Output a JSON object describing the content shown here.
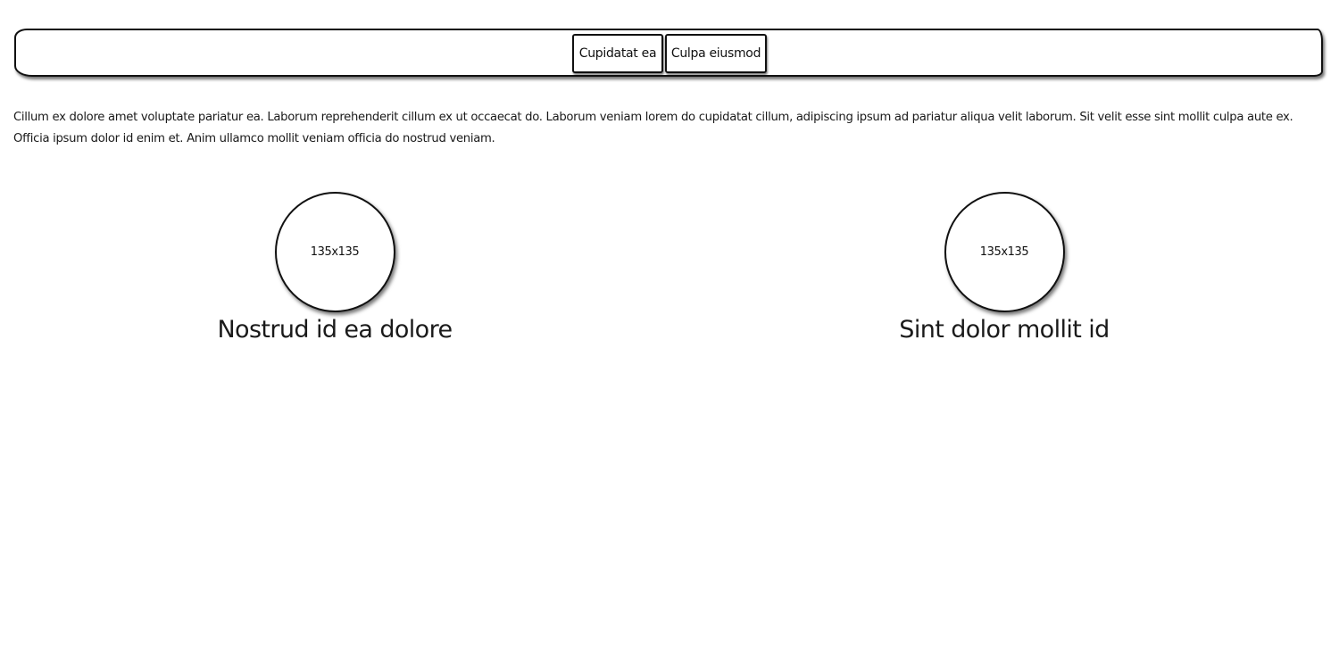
{
  "navbar": {
    "buttons": [
      {
        "label": "Cupidatat ea"
      },
      {
        "label": "Culpa eiusmod"
      }
    ]
  },
  "content": {
    "paragraph": "Cillum ex dolore amet voluptate pariatur ea. Laborum reprehenderit cillum ex ut occaecat do. Laborum veniam lorem do cupidatat cillum, adipiscing ipsum ad pariatur aliqua velit laborum. Sit velit esse sint mollit culpa aute ex. Officia ipsum dolor id enim et. Anim ullamco mollit veniam officia do nostrud veniam."
  },
  "cards": [
    {
      "image_placeholder": "135x135",
      "title": "Nostrud id ea dolore"
    },
    {
      "image_placeholder": "135x135",
      "title": "Sint dolor mollit id"
    }
  ]
}
